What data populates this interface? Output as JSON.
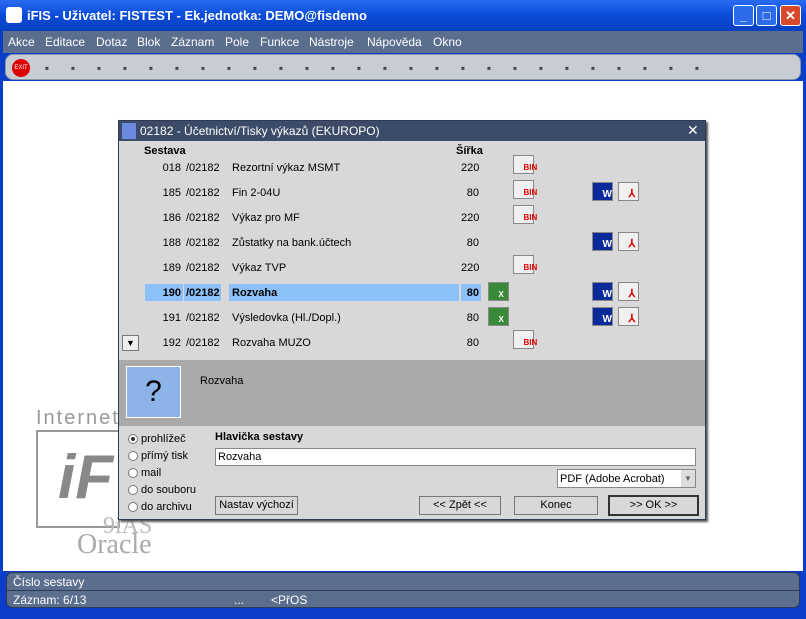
{
  "window": {
    "title": "iFIS - Uživatel: FISTEST - Ek.jednotka: DEMO@fisdemo",
    "minimize": "_",
    "maximize": "□",
    "close": "✕"
  },
  "menu": [
    "Akce",
    "Editace",
    "Dotaz",
    "Blok",
    "Záznam",
    "Pole",
    "Funkce",
    "Nástroje",
    "Nápověda",
    "Okno"
  ],
  "toolbar": {
    "exit_label": "EXIT",
    "icons": [
      "exit-icon",
      "insert-record-icon",
      "duplicate-record-icon",
      "delete-record-icon",
      "enter-query-icon",
      "execute-query-icon",
      "cancel-query-icon",
      "sort-asc-icon",
      "sort-desc-icon",
      "filter-icon",
      "print-icon",
      "print-setup-icon",
      "cut-icon",
      "copy-icon",
      "paste-icon",
      "search-icon",
      "list-icon",
      "tree-icon",
      "report-icon",
      "settings-icon",
      "chart-icon",
      "calc-icon",
      "sum-icon",
      "excel-icon",
      "ie-icon",
      "help-icon",
      "context-help-icon"
    ]
  },
  "background": {
    "logo_top": "Internet",
    "logo_mid": "9iAS",
    "logo_bottom": "Oracle"
  },
  "dialog": {
    "title": "02182 - Účetnictví/Tisky výkazů (EKUROPO)",
    "col_sestava": "Sestava",
    "col_sirka": "Šířka",
    "rows": [
      {
        "num": "018",
        "code": "/02182",
        "name": "Rezortní výkaz MSMT",
        "width": "220",
        "excel": false,
        "bin": true,
        "word": false,
        "pdf": false
      },
      {
        "num": "185",
        "code": "/02182",
        "name": "Fin 2-04U",
        "width": "80",
        "excel": false,
        "bin": true,
        "word": true,
        "pdf": true
      },
      {
        "num": "186",
        "code": "/02182",
        "name": "Výkaz pro MF",
        "width": "220",
        "excel": false,
        "bin": true,
        "word": false,
        "pdf": false
      },
      {
        "num": "188",
        "code": "/02182",
        "name": "Zůstatky na bank.účtech",
        "width": "80",
        "excel": false,
        "bin": false,
        "word": true,
        "pdf": true
      },
      {
        "num": "189",
        "code": "/02182",
        "name": "Výkaz TVP",
        "width": "220",
        "excel": false,
        "bin": true,
        "word": false,
        "pdf": false
      },
      {
        "num": "190",
        "code": "/02182",
        "name": "Rozvaha",
        "width": "80",
        "excel": true,
        "bin": false,
        "word": true,
        "pdf": true,
        "selected": true
      },
      {
        "num": "191",
        "code": "/02182",
        "name": "Výsledovka (Hl./Dopl.)",
        "width": "80",
        "excel": true,
        "bin": false,
        "word": true,
        "pdf": true
      },
      {
        "num": "192",
        "code": "/02182",
        "name": "Rozvaha MUZO",
        "width": "80",
        "excel": false,
        "bin": true,
        "word": false,
        "pdf": false
      }
    ],
    "icon_labels": {
      "bin": "BIN",
      "word": "W",
      "excel": "X",
      "pdf": "⅄"
    },
    "description": "Rozvaha",
    "radios": [
      {
        "label": "prohlížeč",
        "checked": true
      },
      {
        "label": "přímý tisk"
      },
      {
        "label": "mail"
      },
      {
        "label": "do souboru"
      },
      {
        "label": "do archivu"
      }
    ],
    "header_label": "Hlavička sestavy",
    "header_value": "Rozvaha",
    "format": "PDF (Adobe Acrobat)",
    "btn_default": "Nastav výchozí",
    "btn_back": "<< Zpět <<",
    "btn_end": "Konec",
    "btn_ok": ">> OK >>"
  },
  "status": {
    "hint": "Číslo sestavy",
    "record": "Záznam: 6/13",
    "dots": "...",
    "mode": "<PřOS"
  }
}
